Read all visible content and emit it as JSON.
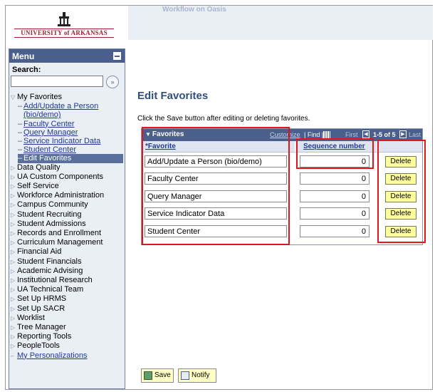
{
  "header": {
    "university_name": "UNIVERSITY of ARKANSAS",
    "top_text": "Workflow on Oasis"
  },
  "menu": {
    "title": "Menu",
    "search_label": "Search:",
    "search_value": "",
    "search_go_icon": "double-chevron-icon",
    "favorites": {
      "label": "My Favorites",
      "items": [
        "Add/Update a Person",
        "(bio/demo)",
        "Faculty Center",
        "Query Manager",
        "Service Indicator Data",
        "Student Center",
        "Edit Favorites"
      ]
    },
    "folders": [
      "Data Quality",
      "UA Custom Components",
      "Self Service",
      "Workforce Administration",
      "Campus Community",
      "Student Recruiting",
      "Student Admissions",
      "Records and Enrollment",
      "Curriculum Management",
      "Financial Aid",
      "Student Financials",
      "Academic Advising",
      "Institutional Research",
      "UA Technical Team",
      "Set Up HRMS",
      "Set Up SACR",
      "Worklist",
      "Tree Manager",
      "Reporting Tools",
      "PeopleTools"
    ],
    "personalizations": "My Personalizations"
  },
  "page": {
    "title": "Edit Favorites",
    "instructions": "Click the Save button after editing or deleting favorites."
  },
  "grid": {
    "title": "Favorites",
    "customize": "Customize",
    "find": "| Find |",
    "first": "First",
    "count": "1-5 of 5",
    "last": "Last",
    "col_favorite": "*Favorite",
    "col_sequence": "Sequence number",
    "delete_label": "Delete",
    "rows": [
      {
        "favorite": "Add/Update a Person (bio/demo)",
        "sequence": "0"
      },
      {
        "favorite": "Faculty Center",
        "sequence": "0"
      },
      {
        "favorite": "Query Manager",
        "sequence": "0"
      },
      {
        "favorite": "Service Indicator Data",
        "sequence": "0"
      },
      {
        "favorite": "Student Center",
        "sequence": "0"
      }
    ]
  },
  "footer": {
    "save_label": "Save",
    "notify_label": "Notify"
  },
  "colors": {
    "menu_header": "#4b5f8c",
    "highlight_border": "#e0161b",
    "delete_button": "#ffff9e",
    "title": "#2f4f7f"
  }
}
